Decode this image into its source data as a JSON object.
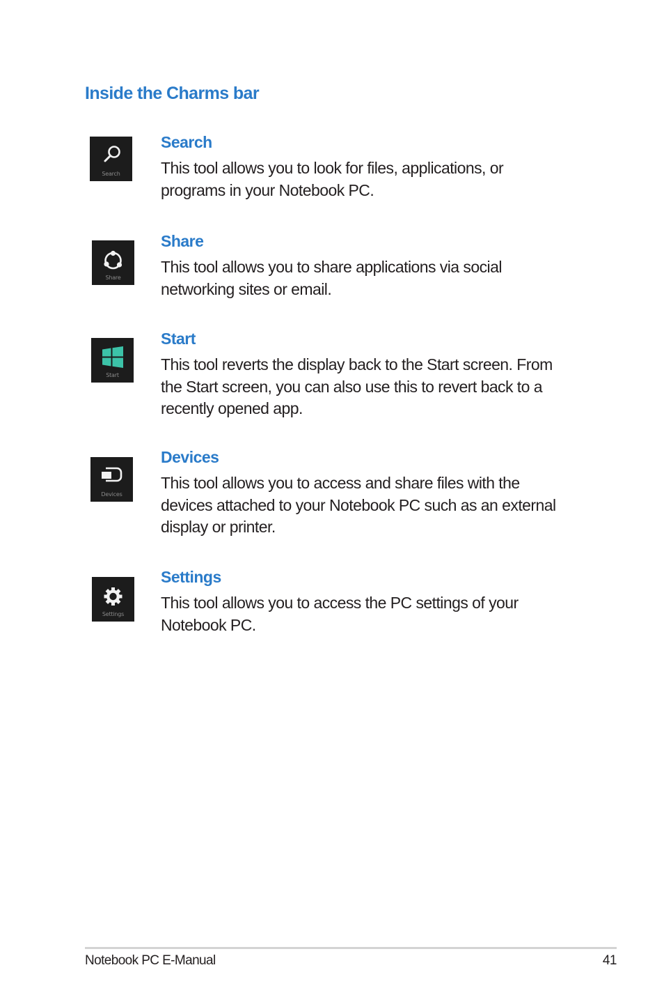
{
  "section": {
    "title": "Inside the Charms bar"
  },
  "charms": [
    {
      "icon": "search-icon",
      "tile_label": "Search",
      "title": "Search",
      "description": "This tool allows you to look for files, applications, or programs in your Notebook PC."
    },
    {
      "icon": "share-icon",
      "tile_label": "Share",
      "title": "Share",
      "description": "This tool allows you to share applications via social networking sites or email."
    },
    {
      "icon": "windows-start-icon",
      "tile_label": "Start",
      "title": "Start",
      "description": "This tool reverts the display back to the Start screen. From the Start screen, you can also use this to revert back to a recently opened app.",
      "accent_color": "#3cc3a8"
    },
    {
      "icon": "devices-icon",
      "tile_label": "Devices",
      "title": "Devices",
      "description": "This tool allows you to access and share files with the devices attached to your Notebook PC such as an external display or printer."
    },
    {
      "icon": "gear-icon",
      "tile_label": "Settings",
      "title": "Settings",
      "description": "This tool allows you to access the PC settings of your Notebook PC."
    }
  ],
  "footer": {
    "manual_title": "Notebook PC E-Manual",
    "page_number": "41"
  },
  "colors": {
    "heading_blue": "#2a7bc9",
    "body_text": "#231f20",
    "tile_background": "#1c1c1c"
  }
}
